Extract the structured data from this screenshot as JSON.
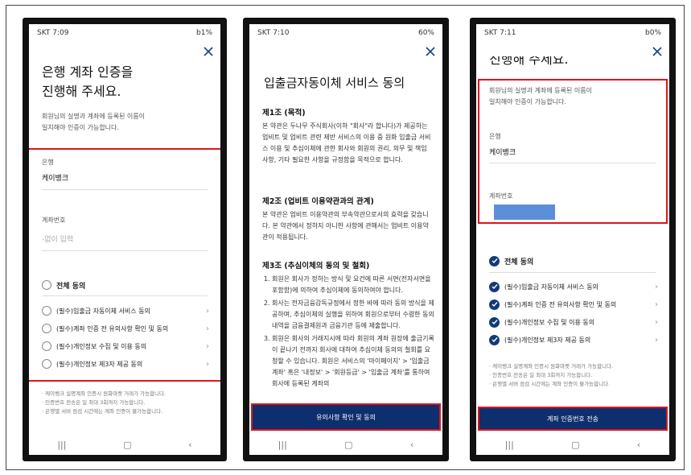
{
  "status": {
    "p1": {
      "time": "SKT 7:09",
      "right": "b1%"
    },
    "p2": {
      "time": "SKT 7:10",
      "right": "60%"
    },
    "p3": {
      "time": "SKT 7:11",
      "right": "b0%"
    }
  },
  "screen1": {
    "title_line1": "은행 계좌 인증을",
    "title_line2": "진행해 주세요.",
    "description": "회원님의 실명과 계좌에 등록된 이름이\n일치해야 인증이 가능합니다.",
    "bank_label": "은행",
    "bank_value": "케이뱅크",
    "account_label": "계좌번호",
    "account_placeholder": "-없이 입력",
    "agree_all": "전체 동의",
    "agreements": [
      "(필수)입출금 자동이체 서비스 동의",
      "(필수)계좌 인증 전 유의사항 확인 및 동의",
      "(필수)개인정보 수집 및 이용 동의",
      "(필수)개인정보 제3자 제공 동의"
    ],
    "notes": [
      "케이뱅크 실명계좌 인증시 원화마켓 거래가 가능합니다.",
      "인증번호 전송은 일 최대 3회까지 가능합니다.",
      "은행별 서버 점검 시간에는 계좌 인증이 불가능합니다."
    ]
  },
  "screen2": {
    "title": "입출금자동이체 서비스 동의",
    "art1_title": "제1조 (목적)",
    "art1_body": "본 약관은 두나무 주식회사(이하 \"회사\"라 합니다)가 제공하는 업비트 및 업비트 관련 제반 서비스의 이용 중 원화 입출금 서비스 이용 및 추심이체에 관한 회사와 회원의 권리, 의무 및 책임 사항, 기타 필요한 사항을 규정함을 목적으로 합니다.",
    "art2_title": "제2조 (업비트 이용약관과의 관계)",
    "art2_body": "본 약관은 업비트 이용약관의 부속약관으로서의 효력을 갖습니다. 본 약관에서 정하지 아니한 사항에 관해서는 업비트 이용약관이 적용됩니다.",
    "art3_title": "제3조 (추심이체의 동의 및 철회)",
    "art3_items": [
      "회원은 회사가 정하는 방식 및 요건에 따른 서면(전자서면을 포함함)에 의하여 추심이체에 동의하여야 합니다.",
      "회사는 전자금융감독규정에서 정한 바에 따라 동의 방식을 제공하며, 추심이체의 실행을 위하여 회원으로부터 수령한 동의 내역을 금융결제원과 금융기관 등에 제출합니다.",
      "회원은 회사의 거래지시에 따라 회원의 계좌 원장에 출금기록이 끝나기 전까지 회사에 대하여 추심이체 동의의 철회를 요청할 수 있습니다. 회원은 서비스의 '마이페이지' > '입출금 계좌' 혹은 '내정보' > '회원등급' > '입출금 계좌'를 통하여 회사에 등록된 계좌의"
    ],
    "confirm_button": "유의사항 확인 및 동의"
  },
  "screen3": {
    "scrolled_title": "진행해 주세요.",
    "description": "회원님의 실명과 계좌에 등록된 이름이\n일치해야 인증이 가능합니다.",
    "bank_label": "은행",
    "bank_value": "케이뱅크",
    "account_label": "계좌번호",
    "agree_all": "전체 동의",
    "agreements": [
      "(필수)입출금 자동이체 서비스 동의",
      "(필수)계좌 인증 전 유의사항 확인 및 동의",
      "(필수)개인정보 수집 및 이용 동의",
      "(필수)개인정보 제3자 제공 동의"
    ],
    "notes": [
      "케이뱅크 실명계좌 인증시 원화마켓 거래가 가능합니다.",
      "인증번호 전송은 일 최대 3회까지 가능합니다.",
      "은행별 서버 점검 시간에는 계좌 인증이 불가능합니다."
    ],
    "send_button": "계좌 인증번호 전송"
  },
  "icons": {
    "close": "close-icon",
    "recents": "recents-icon",
    "home": "home-icon",
    "back": "back-icon"
  },
  "colors": {
    "primary_button": "#0e2f6e",
    "highlight": "#e0141e",
    "check": "#123a7a",
    "masked": "#5b8fd8"
  }
}
